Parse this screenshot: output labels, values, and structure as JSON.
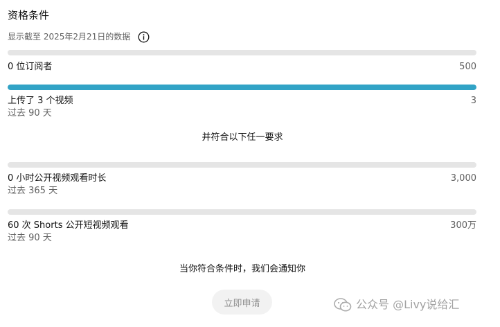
{
  "header": {
    "title": "资格条件",
    "subtitle": "显示截至 2025年2月21日的数据"
  },
  "requirements_primary": [
    {
      "label": "0 位订阅者",
      "target": "500",
      "progress": 0
    },
    {
      "label": "上传了 3 个视频",
      "period": "过去 90 天",
      "target": "3",
      "progress": 1.0
    }
  ],
  "separator_text": "并符合以下任一要求",
  "requirements_alternative": [
    {
      "label": "0 小时公开视频观看时长",
      "period": "过去 365 天",
      "target": "3,000",
      "progress": 0
    },
    {
      "label": "60 次 Shorts 公开短视频观看",
      "period": "过去 90 天",
      "target": "300万",
      "progress": 0
    }
  ],
  "notice": "当你符合条件时，我们会通知你",
  "apply_button": {
    "label": "立即申请",
    "enabled": false
  },
  "watermark": {
    "text": "公众号 @Livy说给汇",
    "icon": "wechat-icon"
  },
  "colors": {
    "progress_fill": "#31a3c6",
    "progress_track": "#e5e5e5",
    "secondary_text": "#606060",
    "button_bg": "#f2f2f2",
    "button_text": "#909090"
  }
}
